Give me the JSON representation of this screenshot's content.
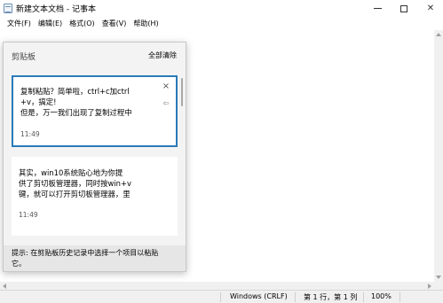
{
  "window": {
    "title": "新建文本文档 - 记事本",
    "icons": {
      "app": "notepad-icon",
      "minimize": "minimize-icon",
      "maximize": "maximize-icon",
      "close": "close-icon"
    }
  },
  "menu": {
    "items": [
      "文件(F)",
      "编辑(E)",
      "格式(O)",
      "查看(V)",
      "帮助(H)"
    ]
  },
  "clipboard_panel": {
    "title": "剪贴板",
    "clear_all": "全部清除",
    "items": [
      {
        "lines": [
          "复制粘贴？简单啦，ctrl+c加ctrl",
          "+v，搞定!",
          "但是，万一我们出现了复制过程中"
        ],
        "time": "11:49",
        "close_icon": "×",
        "pin_icon": "⇦",
        "selected": true
      },
      {
        "lines": [
          "其实，win10系统贴心地为你提",
          "供了剪切板管理器，同时按win+v",
          "键，就可以打开剪切板管理器，里"
        ],
        "time": "11:49",
        "selected": false
      }
    ],
    "footer": "提示: 在剪贴板历史记录中选择一个项目以粘贴它。"
  },
  "statusbar": {
    "line_ending": "Windows (CRLF)",
    "position": "第 1 行，第 1 列",
    "zoom": "100%"
  },
  "colors": {
    "accent": "#2a7ab8",
    "panel_bg": "#f3f3f3",
    "footer_bg": "#e6e6e6"
  }
}
